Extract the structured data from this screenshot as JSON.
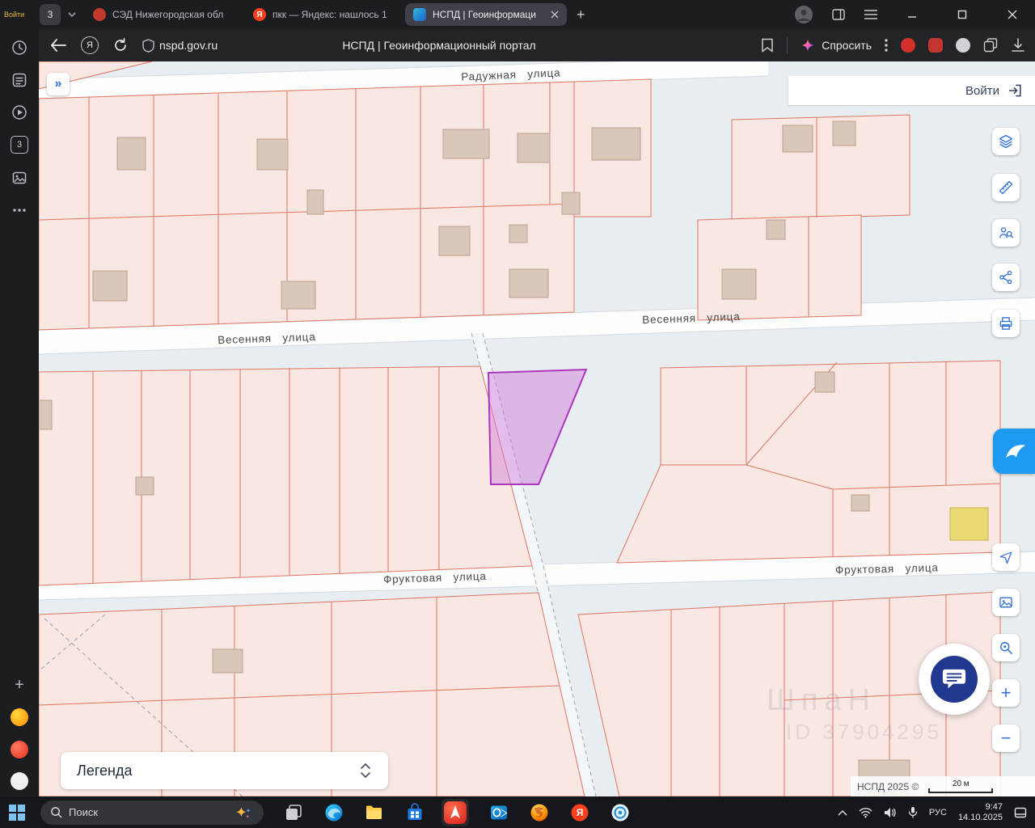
{
  "browser": {
    "sidebar_badge": "Войти",
    "tab_count": "3",
    "ya": "Я",
    "tabs": [
      {
        "title": "СЭД Нижегородская обл"
      },
      {
        "title": "пкк — Яндекс: нашлось 1"
      },
      {
        "title": "НСПД | Геоинформаци"
      }
    ],
    "url": "nspd.gov.ru",
    "page_title": "НСПД | Геоинформационный портал",
    "ask_label": "Спросить"
  },
  "map": {
    "login_label": "Войти",
    "legend_label": "Легенда",
    "streets": [
      {
        "name": "Радужная улица"
      },
      {
        "name": "Весенняя улица"
      },
      {
        "name": "Весенняя улица"
      },
      {
        "name": "Фруктовая улица"
      },
      {
        "name": "Фруктовая улица"
      }
    ],
    "attribution": "НСПД 2025 ©",
    "scale_label": "20 м",
    "watermark_line1": "ШпаН",
    "watermark_line2": "ID 37904295"
  },
  "glyphs": {
    "collapse": "»",
    "zoom_in": "+",
    "zoom_out": "−",
    "new_tab": "+",
    "sidebar_plus": "+"
  },
  "taskbar": {
    "search_label": "Поиск",
    "language": "РУС",
    "time": "9:47",
    "date": "14.10.2025"
  },
  "colors": {
    "parcel_fill": "#f8e7e3",
    "parcel_border": "#de7661",
    "highlight_fill": "#ce76da",
    "highlight_border": "#ae35bd",
    "selected_yellow": "#eada74",
    "control_blue": "#2f6fd8"
  }
}
